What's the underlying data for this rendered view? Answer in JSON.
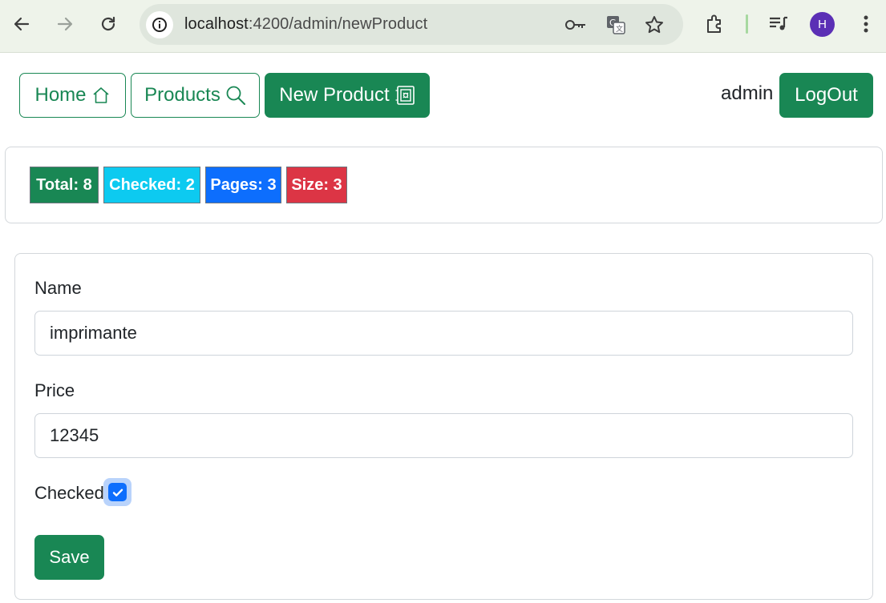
{
  "browser": {
    "url_host": "localhost",
    "url_rest": ":4200/admin/newProduct",
    "avatar_letter": "H"
  },
  "nav": {
    "home_label": "Home",
    "products_label": "Products",
    "new_product_label": "New Product",
    "user_name": "admin",
    "logout_label": "LogOut"
  },
  "stats": {
    "total": "Total: 8",
    "checked": "Checked: 2",
    "pages": "Pages: 3",
    "size": "Size: 3"
  },
  "form": {
    "name_label": "Name",
    "name_value": "imprimante",
    "price_label": "Price",
    "price_value": "12345",
    "checked_label": "Checked",
    "checked_value": true,
    "save_label": "Save"
  },
  "colors": {
    "success": "#198754",
    "info": "#0dcaf0",
    "primary": "#0d6efd",
    "danger": "#dc3545"
  },
  "icons": {
    "home": "house-icon",
    "products": "search-icon",
    "new_product": "safe-icon"
  }
}
